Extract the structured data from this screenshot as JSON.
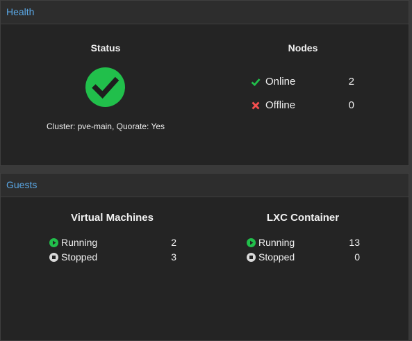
{
  "health": {
    "header": "Health",
    "status_title": "Status",
    "status_icon": "check-circle-icon",
    "status_color": "#21bf4b",
    "cluster_text": "Cluster: pve-main, Quorate: Yes",
    "nodes_title": "Nodes",
    "nodes": [
      {
        "label": "Online",
        "count": "2",
        "icon": "check-icon",
        "color": "#21bf4b"
      },
      {
        "label": "Offline",
        "count": "0",
        "icon": "x-icon",
        "color": "#f54f4f"
      }
    ]
  },
  "guests": {
    "header": "Guests",
    "vm": {
      "title": "Virtual Machines",
      "running_label": "Running",
      "running_count": "2",
      "stopped_label": "Stopped",
      "stopped_count": "3"
    },
    "lxc": {
      "title": "LXC Container",
      "running_label": "Running",
      "running_count": "13",
      "stopped_label": "Stopped",
      "stopped_count": "0"
    },
    "running_icon": "play-circle-icon",
    "stopped_icon": "stop-circle-icon",
    "running_color": "#21bf4b",
    "stopped_color": "#d9d9d9"
  }
}
